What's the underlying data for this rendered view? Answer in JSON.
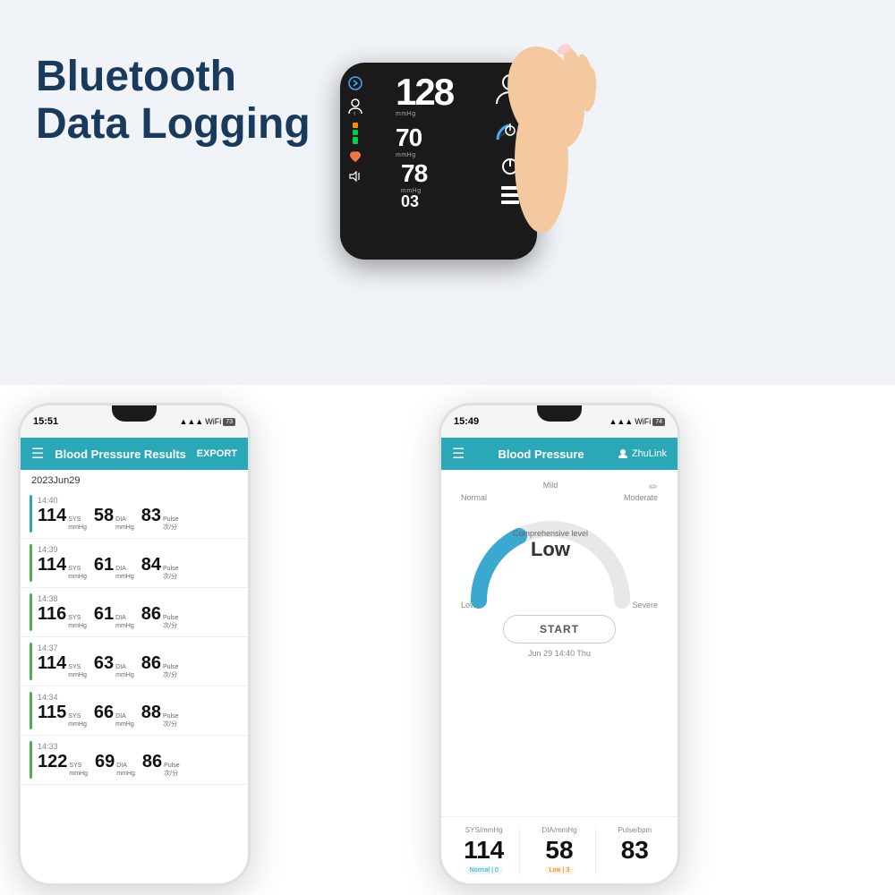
{
  "top": {
    "title_line1": "Bluetooth",
    "title_line2": "Data Logging",
    "device": {
      "sys_value": "128",
      "dia_value": "70",
      "pulse_value": "78",
      "memory_value": "03",
      "mmhg": "mmHg"
    }
  },
  "phone_left": {
    "time": "15:51",
    "signal": "▲▲▲",
    "wifi": "WiFi",
    "battery": "73",
    "header_title": "Blood Pressure Results",
    "export_label": "EXPORT",
    "date_label": "2023Jun29",
    "readings": [
      {
        "time": "14:40",
        "sys": "114",
        "sys_unit": "SYS\nmmHg",
        "dia": "58",
        "dia_unit": "DIA\nmmHg",
        "pulse": "83",
        "pulse_unit": "Pulse\n次/分",
        "color": "#2ba8b8"
      },
      {
        "time": "14:39",
        "sys": "114",
        "sys_unit": "SYS\nmmHg",
        "dia": "61",
        "dia_unit": "DIA\nmmHg",
        "pulse": "84",
        "pulse_unit": "Pulse\n次/分",
        "color": "#4caf50"
      },
      {
        "time": "14:38",
        "sys": "116",
        "sys_unit": "SYS\nmmHg",
        "dia": "61",
        "dia_unit": "DIA\nmmHg",
        "pulse": "86",
        "pulse_unit": "Pulse\n次/分",
        "color": "#4caf50"
      },
      {
        "time": "14:37",
        "sys": "114",
        "sys_unit": "SYS\nmmHg",
        "dia": "63",
        "dia_unit": "DIA\nmmHg",
        "pulse": "86",
        "pulse_unit": "Pulse\n次/分",
        "color": "#4caf50"
      },
      {
        "time": "14:34",
        "sys": "115",
        "sys_unit": "SYS\nmmHg",
        "dia": "66",
        "dia_unit": "DIA\nmmHg",
        "pulse": "88",
        "pulse_unit": "Pulse\n次/分",
        "color": "#4caf50"
      },
      {
        "time": "14:33",
        "sys": "122",
        "sys_unit": "SYS\nmmHg",
        "dia": "69",
        "dia_unit": "DIA\nmmHg",
        "pulse": "86",
        "pulse_unit": "Pulse\n次/分",
        "color": "#4caf50"
      }
    ]
  },
  "phone_right": {
    "time": "15:49",
    "signal": "▲▲▲",
    "wifi": "WiFi",
    "battery": "74",
    "header_title": "Blood Pressure",
    "user_label": "ZhuLink",
    "gauge_labels": {
      "mild": "Mild",
      "normal": "Normal",
      "moderate": "Moderate",
      "low": "Low",
      "severe": "Severe"
    },
    "comprehensive_label": "Comprehensive level",
    "level_text": "Low",
    "start_button": "START",
    "date_label": "Jun 29 14:40 Thu",
    "stats": [
      {
        "header": "SYS/mmHg",
        "value": "114",
        "badge": "Normal | 0",
        "badge_type": "normal"
      },
      {
        "header": "DIA/mmHg",
        "value": "58",
        "badge": "Low | 3",
        "badge_type": "low"
      },
      {
        "header": "Pulse/bpm",
        "value": "83",
        "badge": "",
        "badge_type": ""
      }
    ]
  }
}
